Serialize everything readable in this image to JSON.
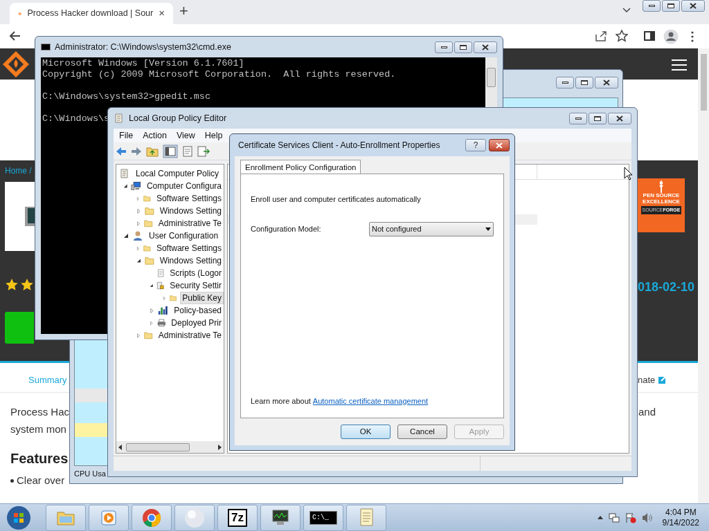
{
  "browser": {
    "tab_title": "Process Hacker download | Sour",
    "tab_close": "×",
    "new_tab": "+"
  },
  "website": {
    "breadcrumb": "Home /",
    "date": "018-02-10",
    "badge": {
      "line1": "PEN SOURCE",
      "line2": "EXCELLENCE",
      "brand_a": "SOURCE",
      "brand_b": "FORGE"
    },
    "nav_left": "Summary",
    "nav_right": "nate",
    "text_left": [
      "Process Hac",
      "system mon"
    ],
    "text_right": "and",
    "heading": "Features",
    "bullet": "Clear over"
  },
  "process_hacker": {
    "status": "CPU Usa"
  },
  "cmd": {
    "title": "Administrator: C:\\Windows\\system32\\cmd.exe",
    "blocks": [
      [
        "Microsoft Windows [Version 6.1.7601]",
        "Copyright (c) 2009 Microsoft Corporation.  All rights reserved."
      ],
      [
        "C:\\Windows\\system32>gpedit.msc"
      ],
      [
        "C:\\Windows\\s"
      ]
    ]
  },
  "gpedit": {
    "title": "Local Group Policy Editor",
    "menu": [
      "File",
      "Action",
      "View",
      "Help"
    ],
    "tree": [
      {
        "label": "Local Computer Policy",
        "kind": "policy",
        "selected": false,
        "children": [
          {
            "label": "Computer Configura",
            "kind": "computer",
            "expanded": true,
            "selected": false,
            "children": [
              {
                "label": "Software Settings",
                "kind": "folder",
                "expanded": false,
                "selected": false
              },
              {
                "label": "Windows Setting",
                "kind": "folder",
                "expanded": false,
                "selected": false
              },
              {
                "label": "Administrative Te",
                "kind": "folder",
                "expanded": false,
                "selected": false
              }
            ]
          },
          {
            "label": "User Configuration",
            "kind": "user",
            "expanded": true,
            "selected": false,
            "children": [
              {
                "label": "Software Settings",
                "kind": "folder",
                "expanded": false,
                "selected": false
              },
              {
                "label": "Windows Setting",
                "kind": "folder",
                "expanded": true,
                "selected": false,
                "children": [
                  {
                    "label": "Scripts (Logor",
                    "kind": "script",
                    "selected": false
                  },
                  {
                    "label": "Security Settir",
                    "kind": "security",
                    "expanded": true,
                    "selected": false,
                    "children": [
                      {
                        "label": "Public Key",
                        "kind": "folder",
                        "expanded": false,
                        "selected": true
                      }
                    ]
                  },
                  {
                    "label": "Policy-based",
                    "kind": "chart",
                    "expanded": false,
                    "selected": false
                  },
                  {
                    "label": "Deployed Prir",
                    "kind": "printer",
                    "expanded": false,
                    "selected": false
                  }
                ]
              },
              {
                "label": "Administrative Te",
                "kind": "folder",
                "expanded": false,
                "selected": false
              }
            ]
          }
        ]
      }
    ]
  },
  "dialog": {
    "title": "Certificate Services Client - Auto-Enrollment Properties",
    "help": "?",
    "tab": {
      "label": "Enrollment Policy Configuration",
      "selected": true
    },
    "description": "Enroll user and computer certificates automatically",
    "field_label": "Configuration Model:",
    "field_value": "Not configured",
    "learn_prefix": "Learn more about",
    "learn_link": "Automatic certificate management",
    "buttons": [
      {
        "label": "OK",
        "default": true,
        "disabled": false
      },
      {
        "label": "Cancel",
        "default": false,
        "disabled": false
      },
      {
        "label": "Apply",
        "default": false,
        "disabled": true
      }
    ]
  },
  "taskbar": {
    "items": [
      {
        "kind": "explorer"
      },
      {
        "kind": "media"
      },
      {
        "kind": "chrome"
      },
      {
        "kind": "ball"
      },
      {
        "kind": "archive",
        "label": "7z"
      },
      {
        "kind": "monitor"
      },
      {
        "kind": "console",
        "label": "C:\\_"
      },
      {
        "kind": "notes"
      }
    ],
    "time": "4:04 PM",
    "date": "9/14/2022"
  }
}
